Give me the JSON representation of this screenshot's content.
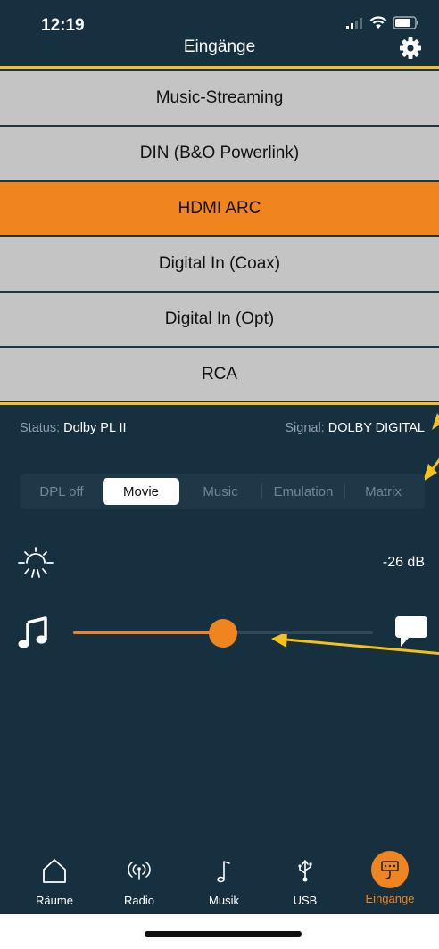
{
  "status_bar": {
    "time": "12:19"
  },
  "header": {
    "title": "Eingänge"
  },
  "inputs": [
    {
      "label": "Music-Streaming",
      "active": false
    },
    {
      "label": "DIN (B&O Powerlink)",
      "active": false
    },
    {
      "label": "HDMI ARC",
      "active": true
    },
    {
      "label": "Digital In (Coax)",
      "active": false
    },
    {
      "label": "Digital In (Opt)",
      "active": false
    },
    {
      "label": "RCA",
      "active": false
    }
  ],
  "info": {
    "status_label": "Status:",
    "status_value": "Dolby PL II",
    "signal_label": "Signal:",
    "signal_value": "DOLBY DIGITAL"
  },
  "modes": [
    "DPL off",
    "Movie",
    "Music",
    "Emulation",
    "Matrix"
  ],
  "selected_mode": "Movie",
  "level": {
    "db": "-26 dB"
  },
  "slider": {
    "value_fraction": 0.5
  },
  "tabs": [
    {
      "label": "Räume",
      "icon": "house-icon"
    },
    {
      "label": "Radio",
      "icon": "radio-icon"
    },
    {
      "label": "Musik",
      "icon": "music-note-icon"
    },
    {
      "label": "USB",
      "icon": "usb-icon"
    },
    {
      "label": "Eingänge",
      "icon": "input-icon"
    }
  ],
  "active_tab": "Eingänge",
  "colors": {
    "background": "#17303f",
    "accent": "#f0841e",
    "highlight_line": "#f5c21b",
    "list_item": "#c4c4c4"
  }
}
